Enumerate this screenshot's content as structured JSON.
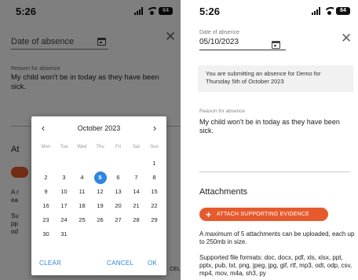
{
  "status_bar": {
    "time": "5:26",
    "battery": "64"
  },
  "form": {
    "date_label": "Date of absence",
    "date_value": "05/10/2023",
    "reason_label": "Reason for absence",
    "reason_text": "My child won't be in today as they have been sick.",
    "notice": "You are submitting an absence for Demo for Thursday 5th of October 2023"
  },
  "calendar": {
    "month_label": "October 2023",
    "weekdays": [
      "Mon",
      "Tue",
      "Wed",
      "Thu",
      "Fri",
      "Sat",
      "Sun"
    ],
    "leading_blanks": 6,
    "days_in_month": 31,
    "selected_day": 5,
    "clear_label": "CLEAR",
    "cancel_label": "CANCEL",
    "ok_label": "OK"
  },
  "background_peek": {
    "attachments_fragment": "At",
    "line_a": "A r",
    "line_b": "ea",
    "line_c": "Su",
    "line_d": "pp",
    "line_e": "od",
    "line_f": "CEL"
  },
  "attachments": {
    "title": "Attachments",
    "button_label": "ATTACH SUPPORTING EVIDENCE",
    "limit_text": "A maximum of 5 attachments can be uploaded, each up to 250mb in size.",
    "formats_text": "Supported file formats: doc, docx, pdf, xls, xlsx, ppt, pptx, pub, txt, png, jpeg, jpg, gif, rtf, mp3, odt, odp, csv, mp4, mov, m4a, sh3, py"
  },
  "colors": {
    "accent_blue": "#2e86de",
    "attach_orange": "#e65a2e"
  },
  "icons": [
    "signal-icon",
    "wifi-icon",
    "battery-icon",
    "close-icon",
    "calendar-icon",
    "chevron-left-icon",
    "chevron-right-icon",
    "plus-icon"
  ]
}
